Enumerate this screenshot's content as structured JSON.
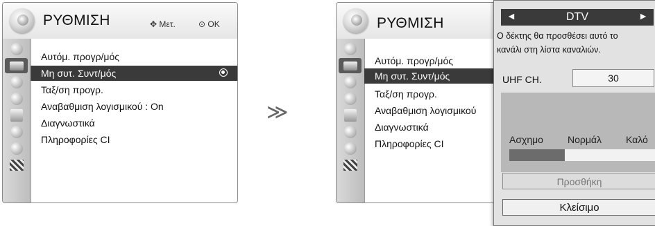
{
  "menu": {
    "title": "ΡΥΘΜΙΣΗ",
    "hint_move": "Μετ.",
    "hint_ok": "OK",
    "items": [
      {
        "label": "Αυτόμ. προγρ/μός"
      },
      {
        "label": "Μη συτ. Συντ/μός"
      },
      {
        "label": "Ταξ/ση προγρ."
      },
      {
        "label": "Αναβαθμιση λογισμικού  : On"
      },
      {
        "label": "Διαγνωστικά"
      },
      {
        "label": "Πληροφορίες CI"
      }
    ],
    "selected_index": 1,
    "icons": [
      "satellite-dish-icon",
      "tv-icon",
      "speaker-icon",
      "clock-icon",
      "lock-box-icon",
      "padlock-icon",
      "globe-icon",
      "clapperboard-icon"
    ]
  },
  "menu2": {
    "title": "ΡΥΘΜΙΣΗ",
    "items": [
      {
        "label": "Αυτόμ. προγρ/μός"
      },
      {
        "label": "Μη συτ. Συντ/μός"
      },
      {
        "label": "Ταξ/ση προγρ."
      },
      {
        "label": "Αναβαθμιση λογισμικού"
      },
      {
        "label": "Διαγνωστικά"
      },
      {
        "label": "Πληροφορίες CI"
      }
    ]
  },
  "arrow_glyph": "≫",
  "popup": {
    "left_arrow": "◄",
    "right_arrow": "►",
    "channel_type": "DTV",
    "message_line1": "Ο δέκτης θα προσθέσει αυτό το",
    "message_line2": "κανάλι στη λίστα καναλιών.",
    "uhf_label": "UHF CH.",
    "uhf_value": "30",
    "signal_labels": {
      "bad": "Ασχημο",
      "normal": "Νορμάλ",
      "good": "Καλό"
    },
    "signal_level": 0.38,
    "add_button": "Προσθήκη",
    "close_button": "Κλείσιμο"
  }
}
